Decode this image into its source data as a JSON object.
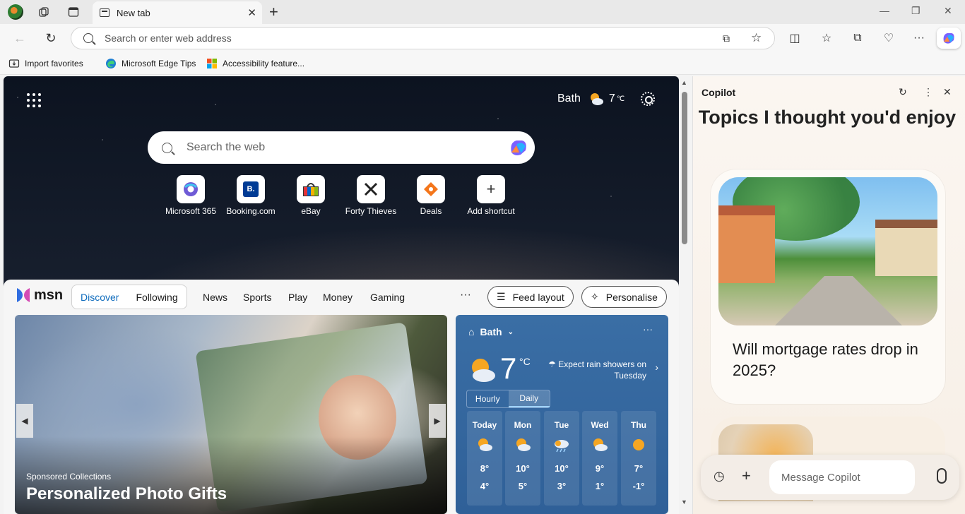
{
  "browser": {
    "tab_title": "New tab",
    "address_placeholder": "Search or enter web address"
  },
  "favorites": [
    {
      "label": "Import favorites"
    },
    {
      "label": "Microsoft Edge Tips"
    },
    {
      "label": "Accessibility feature..."
    }
  ],
  "newtab": {
    "weather": {
      "city": "Bath",
      "temp": "7",
      "unit": "℃"
    },
    "search_placeholder": "Search the web",
    "shortcuts": [
      {
        "label": "Microsoft 365",
        "icon": "m365-icon"
      },
      {
        "label": "Booking.com",
        "icon": "booking-icon"
      },
      {
        "label": "eBay",
        "icon": "ebay-icon"
      },
      {
        "label": "Forty Thieves",
        "icon": "forty-thieves-icon"
      },
      {
        "label": "Deals",
        "icon": "deals-icon"
      },
      {
        "label": "Add shortcut",
        "icon": "plus-icon"
      }
    ],
    "booking_letter": "B."
  },
  "feed": {
    "brand": "msn",
    "tabs": [
      {
        "label": "Discover",
        "active": true
      },
      {
        "label": "Following",
        "active": false
      }
    ],
    "nav": [
      "News",
      "Sports",
      "Play",
      "Money",
      "Gaming"
    ],
    "more": "···",
    "feed_layout": "Feed layout",
    "personalise": "Personalise",
    "hero": {
      "sponsor": "Sponsored Collections",
      "headline": "Personalized Photo Gifts"
    },
    "weather_card": {
      "city": "Bath",
      "temp": "7",
      "unit": "°C",
      "alert": "Expect rain showers on Tuesday",
      "toggle": [
        "Hourly",
        "Daily"
      ],
      "days": [
        {
          "name": "Today",
          "hi": "8°",
          "lo": "4°"
        },
        {
          "name": "Mon",
          "hi": "10°",
          "lo": "5°"
        },
        {
          "name": "Tue",
          "hi": "10°",
          "lo": "3°"
        },
        {
          "name": "Wed",
          "hi": "9°",
          "lo": "1°"
        },
        {
          "name": "Thu",
          "hi": "7°",
          "lo": "-1°"
        }
      ]
    }
  },
  "copilot": {
    "title": "Copilot",
    "topics_heading": "Topics I thought you'd enjoy",
    "card_question": "Will mortgage rates drop in 2025?",
    "message_placeholder": "Message Copilot"
  },
  "colors": {
    "accent": "#0f6cbd",
    "weather_card": "#3a6ea5"
  }
}
